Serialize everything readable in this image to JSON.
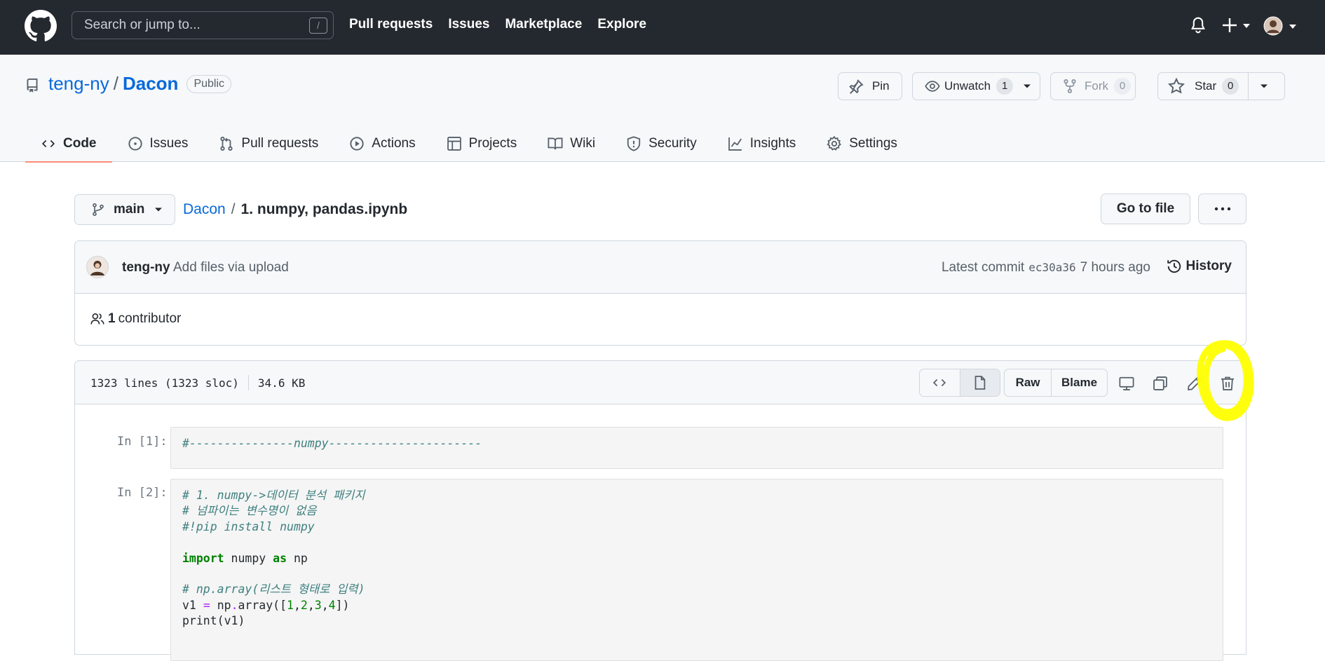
{
  "header": {
    "search_placeholder": "Search or jump to...",
    "search_shortcut": "/",
    "nav": [
      "Pull requests",
      "Issues",
      "Marketplace",
      "Explore"
    ]
  },
  "repo": {
    "owner": "teng-ny",
    "name": "Dacon",
    "visibility": "Public",
    "pin_label": "Pin",
    "unwatch_label": "Unwatch",
    "watch_count": "1",
    "fork_label": "Fork",
    "fork_count": "0",
    "star_label": "Star",
    "star_count": "0"
  },
  "tabs": [
    {
      "label": "Code",
      "icon": "code-icon",
      "selected": true
    },
    {
      "label": "Issues",
      "icon": "issue-icon"
    },
    {
      "label": "Pull requests",
      "icon": "pull-request-icon"
    },
    {
      "label": "Actions",
      "icon": "play-icon"
    },
    {
      "label": "Projects",
      "icon": "table-icon"
    },
    {
      "label": "Wiki",
      "icon": "book-icon"
    },
    {
      "label": "Security",
      "icon": "shield-icon"
    },
    {
      "label": "Insights",
      "icon": "graph-icon"
    },
    {
      "label": "Settings",
      "icon": "gear-icon"
    }
  ],
  "file_nav": {
    "branch": "main",
    "breadcrumb_root": "Dacon",
    "breadcrumb_sep": "/",
    "file_name": "1. numpy, pandas.ipynb",
    "go_to_file": "Go to file"
  },
  "commit": {
    "author": "teng-ny",
    "message": "Add files via upload",
    "latest_label": "Latest commit",
    "sha": "ec30a36",
    "time": "7 hours ago",
    "history_label": "History",
    "contributor_count": "1",
    "contributor_label": "contributor"
  },
  "file": {
    "lines": "1323 lines (1323 sloc)",
    "size": "34.6 KB",
    "raw_label": "Raw",
    "blame_label": "Blame"
  },
  "cells": [
    {
      "prompt": "In [1]:",
      "code": "#---------------numpy----------------------"
    },
    {
      "prompt": "In [2]:",
      "lines": [
        "# 1. numpy->데이터 분석 패키지",
        "# 넘파이는 변수명이 없음",
        "#!pip install numpy",
        "",
        "import numpy as np",
        "",
        "# np.array(리스트 형태로 입력)",
        "v1 = np.array([1,2,3,4])",
        "print(v1)"
      ]
    }
  ],
  "colors": {
    "header_bg": "#24292f",
    "link": "#0969da",
    "selected_tab_underline": "#fd8c73",
    "annotation_highlight": "#ffff00"
  }
}
